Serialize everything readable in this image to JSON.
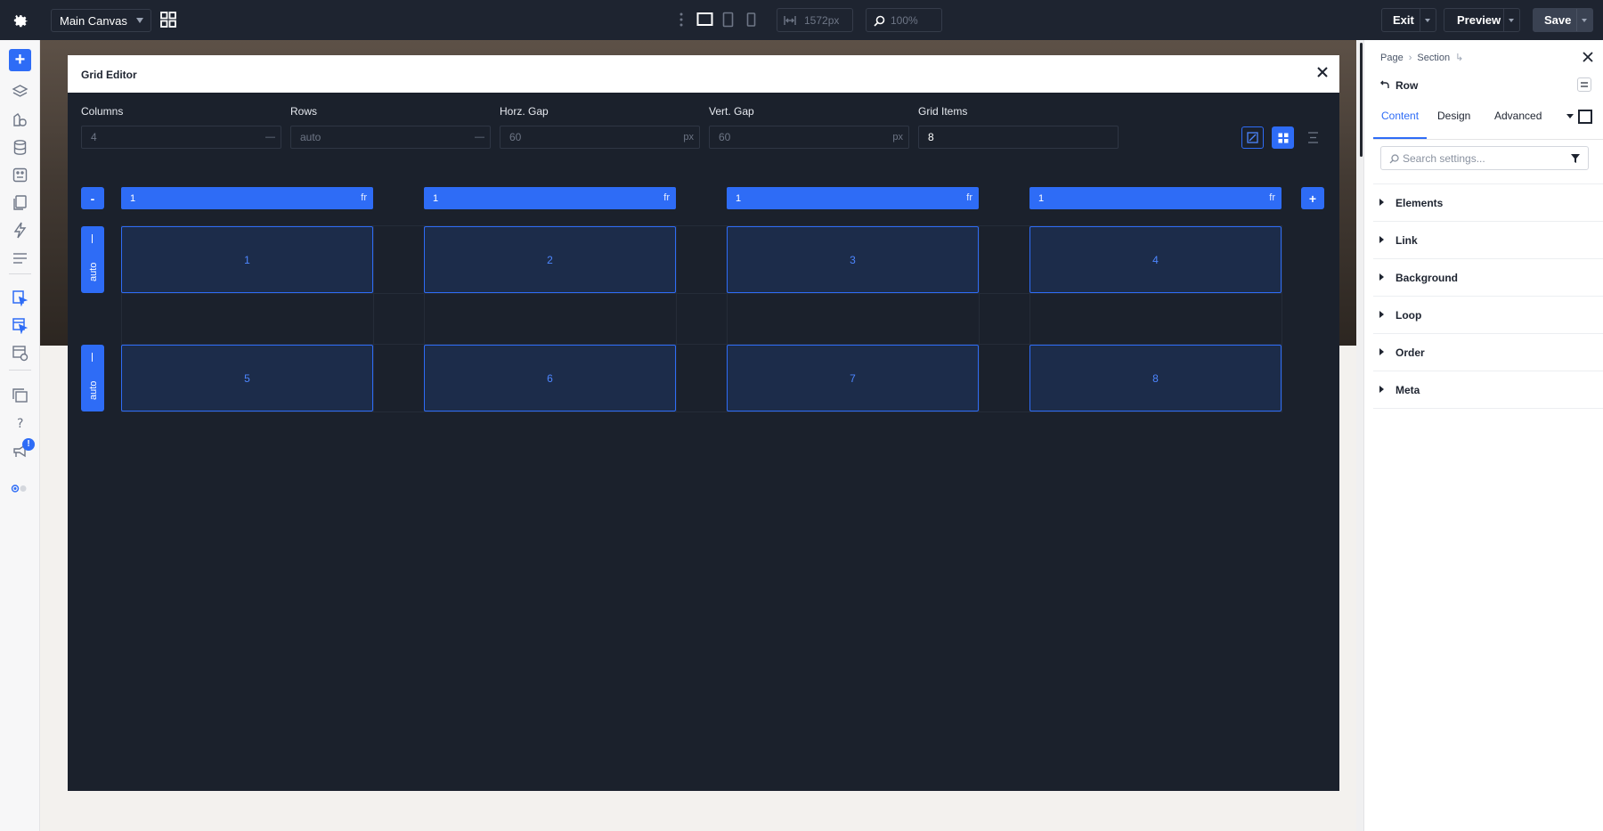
{
  "topbar": {
    "canvas_name": "Main Canvas",
    "width_value": "1572px",
    "zoom_value": "100%",
    "exit_label": "Exit",
    "preview_label": "Preview",
    "save_label": "Save"
  },
  "modal": {
    "title": "Grid Editor",
    "fields": {
      "columns": {
        "label": "Columns",
        "value": "4",
        "suffix": "—"
      },
      "rows": {
        "label": "Rows",
        "value": "auto",
        "suffix": "—"
      },
      "horz_gap": {
        "label": "Horz. Gap",
        "value": "60",
        "suffix": "px"
      },
      "vert_gap": {
        "label": "Vert. Gap",
        "value": "60",
        "suffix": "px"
      },
      "grid_items": {
        "label": "Grid Items",
        "value": "8"
      }
    },
    "minus_label": "-",
    "plus_label": "+",
    "columns_bars": [
      {
        "value": "1",
        "unit": "fr"
      },
      {
        "value": "1",
        "unit": "fr"
      },
      {
        "value": "1",
        "unit": "fr"
      },
      {
        "value": "1",
        "unit": "fr"
      }
    ],
    "rows_handles": [
      {
        "label": "auto"
      },
      {
        "label": "auto"
      }
    ],
    "cells": [
      "1",
      "2",
      "3",
      "4",
      "5",
      "6",
      "7",
      "8"
    ]
  },
  "panel": {
    "breadcrumbs": [
      "Page",
      "Section"
    ],
    "element_title": "Row",
    "tabs": [
      "Content",
      "Design",
      "Advanced"
    ],
    "active_tab": "Content",
    "search_placeholder": "Search settings...",
    "sections": [
      "Elements",
      "Link",
      "Background",
      "Loop",
      "Order",
      "Meta"
    ]
  },
  "leftrail": {
    "notification_count": "!"
  },
  "colors": {
    "accent": "#2e6cf6",
    "dark_bg": "#1b212c",
    "topbar": "#1e2430"
  }
}
